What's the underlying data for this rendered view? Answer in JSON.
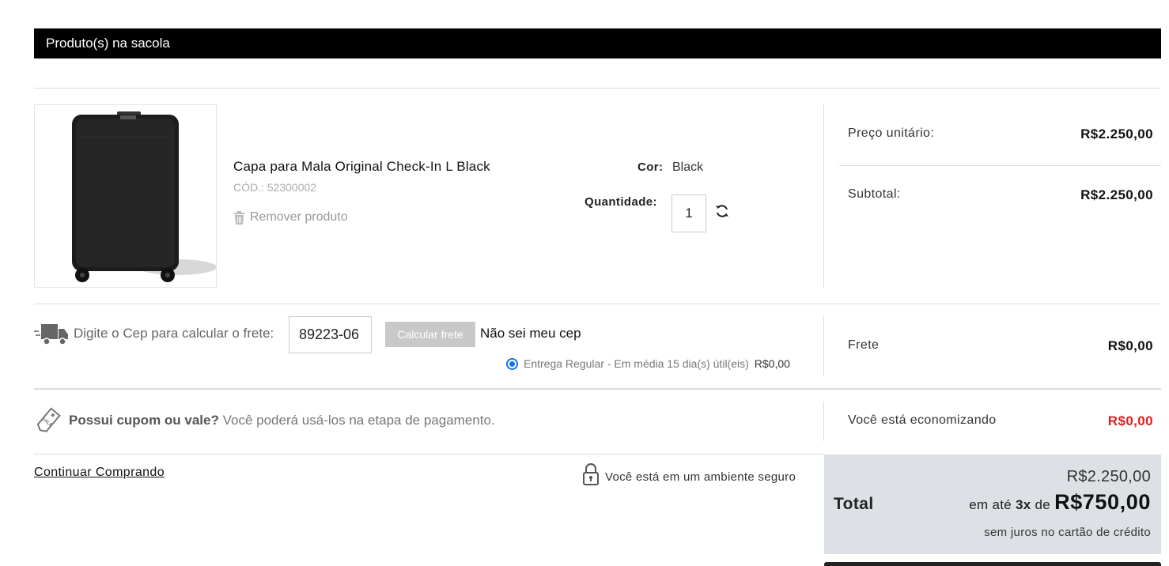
{
  "header": {
    "title": "Produto(s) na sacola"
  },
  "product": {
    "image_alt": "suitcase-image",
    "name": "Capa para Mala Original Check-In L Black",
    "code": "CÓD.: 52300002",
    "remove_label": "Remover produto",
    "color_label": "Cor:",
    "color_value": "Black",
    "qty_label": "Quantidade:",
    "qty_value": "1"
  },
  "summary": {
    "unit_price_label": "Preço unitário:",
    "unit_price_value": "R$2.250,00",
    "subtotal_label": "Subtotal:",
    "subtotal_value": "R$2.250,00",
    "shipping_label": "Frete",
    "shipping_value": "R$0,00",
    "saving_label": "Você está economizando",
    "saving_value": "R$0,00"
  },
  "shipping": {
    "cep_label": "Digite o Cep para calcular o frete:",
    "cep_value": "89223-06",
    "calc_button": "Calcular frete",
    "unknown_cep": "Não sei meu cep",
    "option_label": "Entrega Regular - Em média 15 dia(s) útil(eis)",
    "option_price": "R$0,00"
  },
  "coupon": {
    "question": "Possui cupom ou vale?",
    "text": " Você poderá usá-los na etapa de pagamento."
  },
  "footer": {
    "continue_label": "Continuar Comprando",
    "secure_label": "Você está em um ambiente seguro"
  },
  "total": {
    "label": "Total",
    "full_value": "R$2.250,00",
    "inst_prefix": "em até ",
    "inst_count": "3x",
    "inst_mid": " de ",
    "inst_value": "R$750,00",
    "note": "sem juros no cartão de crédito"
  },
  "colors": {
    "header_bg": "#000000",
    "saving_red": "#e02020",
    "radio_blue": "#1a73e8",
    "total_bg": "#dde1e5"
  },
  "icons": [
    "trash-icon",
    "refresh-icon",
    "truck-icon",
    "sale-tag-icon",
    "lock-icon"
  ]
}
